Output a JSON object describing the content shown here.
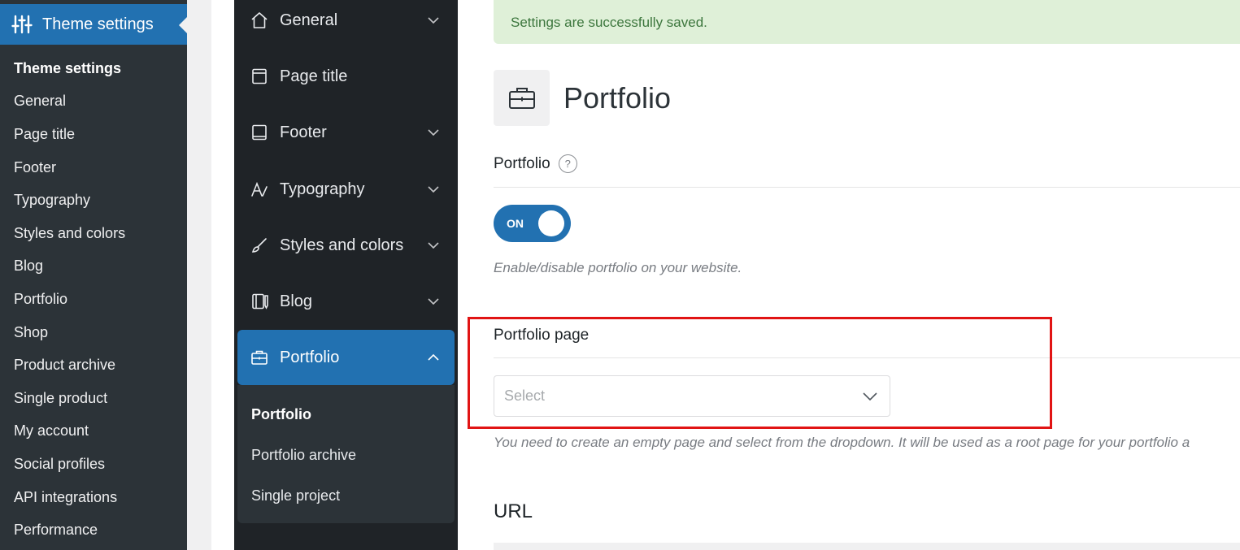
{
  "wp_sidebar": {
    "active_menu": "Theme settings",
    "items": [
      {
        "label": "Theme settings",
        "current": true
      },
      {
        "label": "General"
      },
      {
        "label": "Page title"
      },
      {
        "label": "Footer"
      },
      {
        "label": "Typography"
      },
      {
        "label": "Styles and colors"
      },
      {
        "label": "Blog"
      },
      {
        "label": "Portfolio"
      },
      {
        "label": "Shop"
      },
      {
        "label": "Product archive"
      },
      {
        "label": "Single product"
      },
      {
        "label": "My account"
      },
      {
        "label": "Social profiles"
      },
      {
        "label": "API integrations"
      },
      {
        "label": "Performance"
      }
    ]
  },
  "theme_nav": {
    "items": [
      {
        "label": "General",
        "icon": "home-icon"
      },
      {
        "label": "Page title",
        "icon": "page-icon"
      },
      {
        "label": "Footer",
        "icon": "book-icon"
      },
      {
        "label": "Typography",
        "icon": "typography-icon"
      },
      {
        "label": "Styles and colors",
        "icon": "brush-icon"
      },
      {
        "label": "Blog",
        "icon": "notebook-icon"
      },
      {
        "label": "Portfolio",
        "icon": "briefcase-icon",
        "active": true
      }
    ],
    "portfolio_sub": [
      {
        "label": "Portfolio",
        "current": true
      },
      {
        "label": "Portfolio archive"
      },
      {
        "label": "Single project"
      }
    ]
  },
  "main": {
    "notice": "Settings are successfully saved.",
    "page_title": "Portfolio",
    "portfolio_setting": {
      "label": "Portfolio",
      "help": "?",
      "toggle_text": "ON",
      "toggle_on": true,
      "description": "Enable/disable portfolio on your website."
    },
    "portfolio_page": {
      "label": "Portfolio page",
      "select_placeholder": "Select",
      "description": "You need to create an empty page and select from the dropdown. It will be used as a root page for your portfolio a"
    },
    "url_label": "URL"
  },
  "colors": {
    "accent": "#2271b1",
    "sidebar": "#2c3338",
    "nav": "#1f2327",
    "notice_bg": "#dff0d8",
    "notice_text": "#3c763d",
    "highlight": "#e11414"
  }
}
